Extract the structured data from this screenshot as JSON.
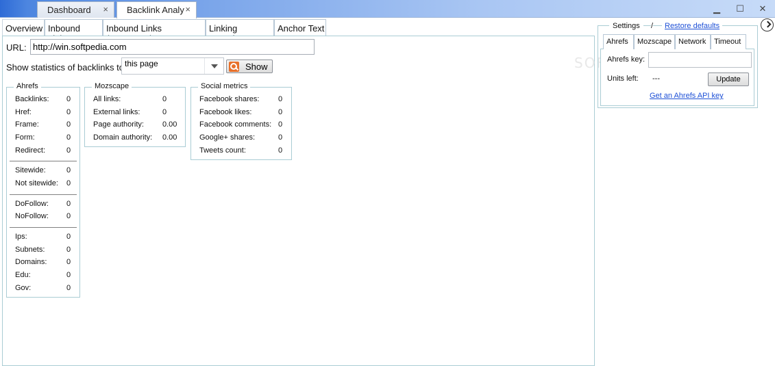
{
  "window": {
    "tabs": [
      {
        "label": "Dashboard",
        "close": "×"
      },
      {
        "label": "Backlink Analy",
        "close": "×"
      }
    ],
    "controls": {
      "minimize": "▁",
      "maximize": "☐",
      "close": "✕"
    }
  },
  "subtabs": [
    "Overview",
    "Inbound Links",
    "Inbound Links (Mozscape)",
    "Linking Domains",
    "Anchor Text"
  ],
  "form": {
    "url_label": "URL:",
    "url_value": "http://win.softpedia.com",
    "stats_label": "Show statistics of backlinks to:",
    "stats_selected": "this page",
    "show_button": "Show"
  },
  "ahrefs": {
    "title": "Ahrefs",
    "rows": [
      {
        "label": "Backlinks:",
        "value": "0"
      },
      {
        "label": "Href:",
        "value": "0"
      },
      {
        "label": "Frame:",
        "value": "0"
      },
      {
        "label": "Form:",
        "value": "0"
      },
      {
        "label": "Redirect:",
        "value": "0"
      },
      {
        "label": "Sitewide:",
        "value": "0"
      },
      {
        "label": "Not sitewide:",
        "value": "0"
      },
      {
        "label": "DoFollow:",
        "value": "0"
      },
      {
        "label": "NoFollow:",
        "value": "0"
      },
      {
        "label": "Ips:",
        "value": "0"
      },
      {
        "label": "Subnets:",
        "value": "0"
      },
      {
        "label": "Domains:",
        "value": "0"
      },
      {
        "label": "Edu:",
        "value": "0"
      },
      {
        "label": "Gov:",
        "value": "0"
      }
    ]
  },
  "mozscape": {
    "title": "Mozscape",
    "rows": [
      {
        "label": "All links:",
        "value": "0"
      },
      {
        "label": "External links:",
        "value": "0"
      },
      {
        "label": "Page authority:",
        "value": "0.00"
      },
      {
        "label": "Domain authority:",
        "value": "0.00"
      }
    ]
  },
  "social": {
    "title": "Social metrics",
    "rows": [
      {
        "label": "Facebook shares:",
        "value": "0"
      },
      {
        "label": "Facebook likes:",
        "value": "0"
      },
      {
        "label": "Facebook comments:",
        "value": "0"
      },
      {
        "label": "Google+ shares:",
        "value": "0"
      },
      {
        "label": "Tweets count:",
        "value": "0"
      }
    ]
  },
  "settings": {
    "title": "Settings",
    "slash": "/",
    "restore_link": "Restore defaults",
    "tabs": [
      "Ahrefs",
      "Mozscape",
      "Network",
      "Timeout"
    ],
    "key_label": "Ahrefs key:",
    "key_value": "",
    "units_label": "Units left:",
    "units_value": "---",
    "update_button": "Update",
    "api_link": "Get an Ahrefs API key"
  },
  "watermark": "SOFTPEDIA"
}
